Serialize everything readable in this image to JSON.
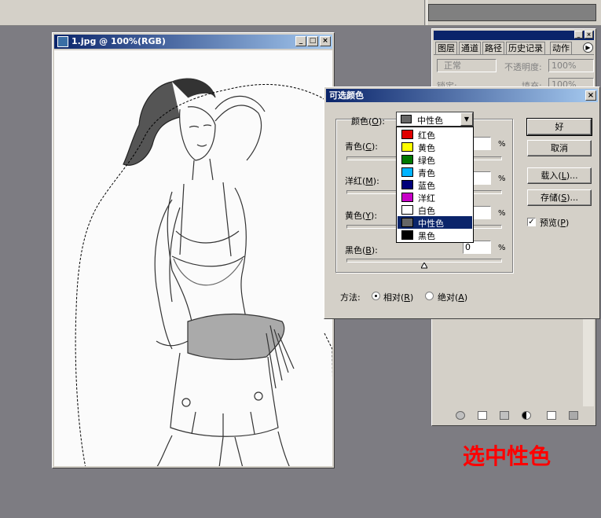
{
  "document": {
    "title": "1.jpg @ 100%(RGB)",
    "controls": [
      "minimize",
      "maximize",
      "close"
    ]
  },
  "layers_panel": {
    "tabs": [
      "图层",
      "通道",
      "路径",
      "历史记录",
      "动作"
    ],
    "blend_mode": "正常",
    "opacity_label": "不透明度:",
    "opacity_value": "100%",
    "lock_label": "锁定:",
    "fill_label": "填充:",
    "fill_value": "100%",
    "caption": "选中性色",
    "caption_color": "#ff0000"
  },
  "dialog": {
    "title": "可选颜色",
    "colors_label": "颜色(",
    "colors_key": "O",
    "colors_suffix": "):",
    "selected_color": "中性色",
    "dropdown_items": [
      {
        "label": "红色",
        "color": "#e00000"
      },
      {
        "label": "黄色",
        "color": "#ffff00"
      },
      {
        "label": "绿色",
        "color": "#007800"
      },
      {
        "label": "青色",
        "color": "#00b4ff"
      },
      {
        "label": "蓝色",
        "color": "#00007a"
      },
      {
        "label": "洋红",
        "color": "#c800c8"
      },
      {
        "label": "白色",
        "color": "#ffffff"
      },
      {
        "label": "中性色",
        "color": "#666666",
        "selected": true
      },
      {
        "label": "黑色",
        "color": "#000000"
      }
    ],
    "sliders": [
      {
        "label": "青色(",
        "key": "C",
        "suffix": "):",
        "value": "",
        "unit": "%"
      },
      {
        "label": "洋红(",
        "key": "M",
        "suffix": "):",
        "value": "",
        "unit": "%"
      },
      {
        "label": "黄色(",
        "key": "Y",
        "suffix": "):",
        "value": "",
        "unit": "%"
      },
      {
        "label": "黑色(",
        "key": "B",
        "suffix": "):",
        "value": "0",
        "unit": "%"
      }
    ],
    "buttons": {
      "ok": "好",
      "cancel": "取消",
      "load_pre": "载入(",
      "load_key": "L",
      "load_post": ")...",
      "save_pre": "存储(",
      "save_key": "S",
      "save_post": ")..."
    },
    "preview_pre": "预览(",
    "preview_key": "P",
    "preview_post": ")",
    "preview_checked": true,
    "method_label": "方法:",
    "method_relative_pre": "相对(",
    "method_relative_key": "R",
    "method_relative_post": ")",
    "method_absolute_pre": "绝对(",
    "method_absolute_key": "A",
    "method_absolute_post": ")",
    "method_selected": "relative"
  }
}
